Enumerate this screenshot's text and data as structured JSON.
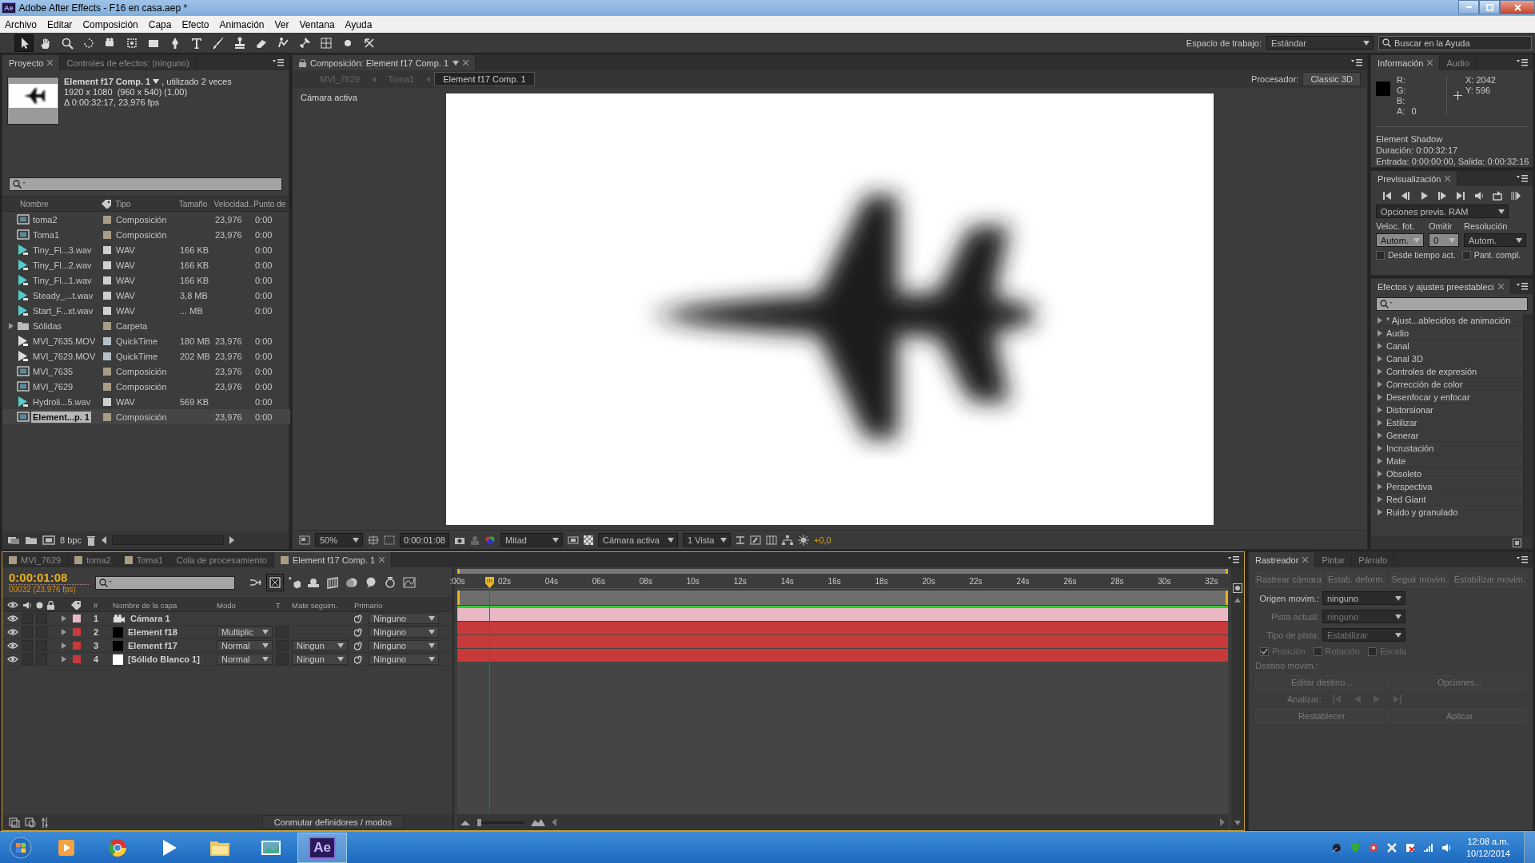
{
  "window": {
    "title": "Adobe After Effects - F16 en casa.aep *",
    "app_badge": "Ae"
  },
  "menu": [
    "Archivo",
    "Editar",
    "Composición",
    "Capa",
    "Efecto",
    "Animación",
    "Ver",
    "Ventana",
    "Ayuda"
  ],
  "tools": [
    {
      "kind": "select",
      "selected": true
    },
    {
      "kind": "hand",
      "selected": false
    },
    {
      "kind": "zoom",
      "selected": false
    },
    {
      "kind": "rotate",
      "selected": false
    },
    {
      "kind": "camera",
      "selected": false
    },
    {
      "kind": "pan",
      "selected": false
    },
    {
      "kind": "rect",
      "selected": false
    },
    {
      "kind": "pen",
      "selected": false
    },
    {
      "kind": "text",
      "selected": false
    },
    {
      "kind": "brush",
      "selected": false
    },
    {
      "kind": "stamp",
      "selected": false
    },
    {
      "kind": "eraser",
      "selected": false
    },
    {
      "kind": "roto",
      "selected": false
    },
    {
      "kind": "pin",
      "selected": false
    },
    {
      "kind": "axis",
      "selected": false
    },
    {
      "kind": "dot",
      "selected": false
    },
    {
      "kind": "world",
      "selected": false
    }
  ],
  "workspace": {
    "label": "Espacio de trabajo:",
    "value": "Estándar"
  },
  "help_search": {
    "placeholder": "Buscar en la Ayuda"
  },
  "project": {
    "tabs": [
      {
        "label": "Proyecto",
        "selected": true
      },
      {
        "label": "Controles de efectos: (ninguno)",
        "selected": false
      }
    ],
    "info": {
      "name": "Element f17 Comp. 1",
      "usage": ", utilizado 2 veces",
      "lines": [
        "1920 x 1080  (960 x 540) (1,00)",
        "Δ 0:00:32:17, 23,976 fps"
      ]
    },
    "columns": [
      "Nombre",
      "Tipo",
      "Tamaño",
      "Velocidad..",
      "Punto de"
    ],
    "rows": [
      {
        "name": "toma2",
        "kind": "comp",
        "color": "#a89c84",
        "type": "Composición",
        "speed": "23,976",
        "start": "0:00",
        "selected": false
      },
      {
        "name": "Toma1",
        "kind": "comp",
        "color": "#a89c84",
        "type": "Composición",
        "speed": "23,976",
        "start": "0:00",
        "selected": false
      },
      {
        "name": "Tiny_Fl...3.wav",
        "kind": "audio",
        "color": "#cfcfcf",
        "type": "WAV",
        "size": "166 KB",
        "start": "0:00",
        "selected": false
      },
      {
        "name": "Tiny_Fl...2.wav",
        "kind": "audio",
        "color": "#cfcfcf",
        "type": "WAV",
        "size": "166 KB",
        "start": "0:00",
        "selected": false
      },
      {
        "name": "Tiny_Fl...1.wav",
        "kind": "audio",
        "color": "#cfcfcf",
        "type": "WAV",
        "size": "166 KB",
        "start": "0:00",
        "selected": false
      },
      {
        "name": "Steady_...t.wav",
        "kind": "audio",
        "color": "#cfcfcf",
        "type": "WAV",
        "size": "3,8 MB",
        "start": "0:00",
        "selected": false
      },
      {
        "name": "Start_F...xt.wav",
        "kind": "audio",
        "color": "#cfcfcf",
        "type": "WAV",
        "size": "... MB",
        "start": "0:00",
        "selected": false
      },
      {
        "name": "Sólidas",
        "kind": "folder",
        "color": "#a89c84",
        "type": "Carpeta",
        "selected": false
      },
      {
        "name": "MVI_7635.MOV",
        "kind": "video",
        "color": "#b4c0c8",
        "type": "QuickTime",
        "size": "180 MB",
        "speed": "23,976",
        "start": "0:00",
        "selected": false
      },
      {
        "name": "MVI_7629.MOV",
        "kind": "video",
        "color": "#b4c0c8",
        "type": "QuickTime",
        "size": "202 MB",
        "speed": "23,976",
        "start": "0:00",
        "selected": false
      },
      {
        "name": "MVI_7635",
        "kind": "comp",
        "color": "#a89c84",
        "type": "Composición",
        "speed": "23,976",
        "start": "0:00",
        "selected": false
      },
      {
        "name": "MVI_7629",
        "kind": "comp",
        "color": "#a89c84",
        "type": "Composición",
        "speed": "23,976",
        "start": "0:00",
        "selected": false
      },
      {
        "name": "Hydroli...5.wav",
        "kind": "audio",
        "color": "#cfcfcf",
        "type": "WAV",
        "size": "569 KB",
        "start": "0:00",
        "selected": false
      },
      {
        "name": "Element...p. 1",
        "kind": "comp",
        "color": "#a89c84",
        "type": "Composición",
        "speed": "23,976",
        "start": "0:00",
        "selected": true
      }
    ],
    "bit_depth": "8 bpc"
  },
  "composition": {
    "tab": "Composición: Element f17 Comp. 1",
    "breadcrumbs": [
      {
        "label": "MVI_7629",
        "selected": false
      },
      {
        "label": "Toma1",
        "selected": false
      },
      {
        "label": "Element f17 Comp. 1",
        "selected": true
      }
    ],
    "renderer_label": "Procesador:",
    "renderer": "Classic 3D",
    "view_label": "Cámara activa",
    "footer": {
      "zoom": "50%",
      "timecode": "0:00:01:08",
      "resolution": "Mitad",
      "camera": "Cámara activa",
      "views": "1 Vista",
      "exposure": "+0,0"
    }
  },
  "info": {
    "tabs": [
      {
        "label": "Información",
        "selected": true
      },
      {
        "label": "Audio",
        "selected": false
      }
    ],
    "channels": [
      {
        "label": "R:"
      },
      {
        "label": "G:"
      },
      {
        "label": "B:"
      },
      {
        "label": "A:",
        "value": "0"
      }
    ],
    "x": "X:  2042",
    "y": "Y:  596",
    "lines": [
      "Element Shadow",
      "Duración: 0:00:32:17",
      "Entrada: 0:00:00:00, Salida: 0:00:32:16"
    ]
  },
  "preview": {
    "tab": "Previsualización",
    "options": "Opciones previs. RAM",
    "fields": [
      {
        "label": "Veloc. fot.",
        "value": "Autom."
      },
      {
        "label": "Omitir",
        "value": "0"
      },
      {
        "label": "Resolución",
        "value": "Autom."
      }
    ],
    "checks": [
      {
        "label": "Desde tiempo act.",
        "checked": false
      },
      {
        "label": "Pant. compl.",
        "checked": false
      }
    ]
  },
  "effects": {
    "tab": "Efectos y ajustes preestableci",
    "items": [
      "* Ajust...ablecidos de animación",
      "Audio",
      "Canal",
      "Canal 3D",
      "Controles de expresión",
      "Corrección de color",
      "Desenfocar y enfocar",
      "Distorsionar",
      "Estilizar",
      "Generar",
      "Incrustación",
      "Mate",
      "Obsoleto",
      "Perspectiva",
      "Red Giant",
      "Ruido y granulado"
    ]
  },
  "timeline": {
    "tabs": [
      {
        "label": "MVI_7629",
        "selected": false,
        "color": "#a89c84"
      },
      {
        "label": "toma2",
        "selected": false,
        "color": "#a89c84"
      },
      {
        "label": "Toma1",
        "selected": false,
        "color": "#a89c84"
      },
      {
        "label": "Cola de procesamiento",
        "selected": false
      },
      {
        "label": "Element f17 Comp. 1",
        "selected": true,
        "color": "#a89c84"
      }
    ],
    "timecode": "0:00:01:08",
    "frames": "00032 (23.976 fps)",
    "columns": [
      "#",
      "Nombre de la capa",
      "Modo",
      "T",
      "Mate seguim.",
      "Primario"
    ],
    "layers": [
      {
        "number": "1",
        "name": "Cámara 1",
        "kind": "camera",
        "color": "#e8b8c4",
        "parent": "Ninguno"
      },
      {
        "number": "2",
        "name": "Element f18",
        "kind": "dark",
        "color": "#c83a3a",
        "mode": "Multiplic",
        "parent": "Ninguno"
      },
      {
        "number": "3",
        "name": "Element f17",
        "kind": "dark",
        "color": "#c83a3a",
        "mode": "Normal",
        "matte": "Ningun",
        "parent": "Ninguno"
      },
      {
        "number": "4",
        "name": "[Sólido Blanco 1]",
        "kind": "light",
        "color": "#c83a3a",
        "mode": "Normal",
        "matte": "Ningun",
        "parent": "Ninguno"
      }
    ],
    "ticks": [
      ":00s",
      "02s",
      "04s",
      "06s",
      "08s",
      "10s",
      "12s",
      "14s",
      "16s",
      "18s",
      "20s",
      "22s",
      "24s",
      "26s",
      "28s",
      "30s",
      "32s"
    ],
    "playhead": {
      "level": 0.041
    },
    "zoom_slider": {
      "level": 0.05
    },
    "switch_button": "Conmutar definidores / modos"
  },
  "tracker": {
    "tabs": [
      {
        "label": "Rastreador",
        "selected": true
      },
      {
        "label": "Pintar",
        "selected": false
      },
      {
        "label": "Párrafo",
        "selected": false
      }
    ],
    "buttons": [
      {
        "label": "Rastrear cámara",
        "disabled": true
      },
      {
        "label": "Estab. deform.",
        "disabled": true
      },
      {
        "label": "Seguir movim.",
        "disabled": true
      },
      {
        "label": "Estabilizar movim.",
        "disabled": true
      }
    ],
    "fields": [
      {
        "label": "Origen movim.:",
        "value": "ninguno",
        "disabled": false
      },
      {
        "label": "Pista actual:",
        "value": "ninguno",
        "disabled": true
      },
      {
        "label": "Tipo de pista:",
        "value": "Estabilizar",
        "disabled": true
      }
    ],
    "checks": [
      {
        "label": "Posición",
        "checked": true
      },
      {
        "label": "Rotación",
        "checked": false
      },
      {
        "label": "Escala",
        "checked": false
      }
    ],
    "target_label": "Destino movim.:",
    "mid_buttons": [
      {
        "label": "Editar destino...",
        "disabled": true
      },
      {
        "label": "Opciones...",
        "disabled": true
      }
    ],
    "analyze_label": "Analizar:",
    "bottom_buttons": [
      {
        "label": "Restablecer",
        "disabled": true
      },
      {
        "label": "Aplicar",
        "disabled": true
      }
    ]
  },
  "taskbar": {
    "apps": [
      {
        "kind": "media",
        "selected": false
      },
      {
        "kind": "browser",
        "selected": false
      },
      {
        "kind": "play",
        "selected": false
      },
      {
        "kind": "folder",
        "selected": false
      },
      {
        "kind": "photo",
        "selected": false
      },
      {
        "kind": "ae",
        "label": "Ae",
        "selected": true
      }
    ],
    "time": "12:08 a.m.",
    "date": "10/12/2014"
  }
}
